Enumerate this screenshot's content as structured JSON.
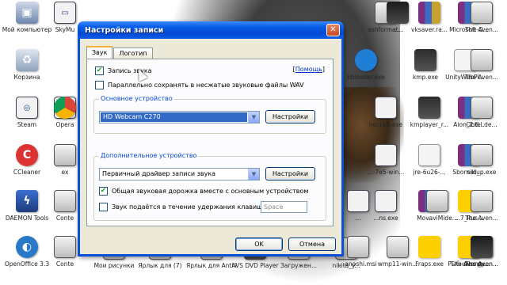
{
  "desktop": {
    "icons": [
      {
        "label": "Мой компьютер",
        "glyph": "▣",
        "style": "g-pc"
      },
      {
        "label": "Корзина",
        "glyph": "♻",
        "style": "g-bin"
      },
      {
        "label": "Steam",
        "glyph": "◎",
        "style": "g-exe"
      },
      {
        "label": "CCleaner",
        "glyph": "C",
        "style": "g-cc"
      },
      {
        "label": "DAEMON Tools",
        "glyph": "ϟ",
        "style": "g-daemon"
      },
      {
        "label": "OpenOffice 3.3",
        "glyph": "◐",
        "style": "g-oo"
      },
      {
        "label": "SkyMu",
        "glyph": "▭",
        "style": "g-exe"
      },
      {
        "label": "Opera",
        "glyph": "O",
        "style": "g-exe"
      },
      {
        "label": "",
        "glyph": "",
        "style": "g-chrome"
      },
      {
        "label": "ex",
        "glyph": "",
        "style": "g-win"
      },
      {
        "label": "Conte",
        "glyph": "",
        "style": "g-win"
      },
      {
        "label": "Conte",
        "glyph": "",
        "style": "g-win"
      },
      {
        "label": "Мои рисунки",
        "glyph": "",
        "style": "g-win"
      },
      {
        "label": "Ярлык для (7)",
        "glyph": "",
        "style": "g-win"
      },
      {
        "label": "Ярлык для AntiVir D...",
        "glyph": "",
        "style": "g-win"
      },
      {
        "label": "AVS DVD Player",
        "glyph": "▶",
        "style": "g-media"
      },
      {
        "label": "Загружен...",
        "glyph": "",
        "style": "g-win"
      },
      {
        "label": "nikita_y...",
        "glyph": "",
        "style": "g-win"
      },
      {
        "label": "ashformat...",
        "glyph": "",
        "style": "g-win"
      },
      {
        "label": "vksaver.ra...",
        "glyph": "",
        "style": "g-rar"
      },
      {
        "label": "Microsoft-O...",
        "glyph": "",
        "style": "g-rar"
      },
      {
        "label": "The Aven...",
        "glyph": "",
        "style": "g-win"
      },
      {
        "label": "kbloader.exe",
        "glyph": "",
        "style": "g-ie"
      },
      {
        "label": "kmp.exe",
        "glyph": "",
        "style": "g-kmp"
      },
      {
        "label": "UnityWebPl...",
        "glyph": "",
        "style": "g-unity"
      },
      {
        "label": "The Aven...",
        "glyph": "",
        "style": "g-win"
      },
      {
        "label": "necraft.exe",
        "glyph": "",
        "style": "g-exe"
      },
      {
        "label": "kmplayer_r...",
        "glyph": "",
        "style": "g-kmp"
      },
      {
        "label": "Aion_2.6...",
        "glyph": "",
        "style": "g-rar"
      },
      {
        "label": "Obtel.de...",
        "glyph": "",
        "style": "g-win"
      },
      {
        "label": "...-7e5-win...",
        "glyph": "",
        "style": "g-exe"
      },
      {
        "label": "jre-6u26-...",
        "glyph": "",
        "style": "g-java"
      },
      {
        "label": "Sborniki_...",
        "glyph": "",
        "style": "g-rar"
      },
      {
        "label": "setup.exe",
        "glyph": "",
        "style": "g-win"
      },
      {
        "label": "...",
        "glyph": "",
        "style": "g-exe"
      },
      {
        "label": "...ns.exe",
        "glyph": "",
        "style": "g-exe"
      },
      {
        "label": "...",
        "glyph": "",
        "style": "g-rar"
      },
      {
        "label": "...7_Rus...",
        "glyph": "",
        "style": "g-yellow"
      },
      {
        "label": "The Aven...",
        "glyph": "",
        "style": "g-win"
      },
      {
        "label": "...anoshi.msi",
        "glyph": "",
        "style": "g-win"
      },
      {
        "label": "wmp11-win...",
        "glyph": "",
        "style": "g-win"
      },
      {
        "label": "Fraps.exe",
        "glyph": "",
        "style": "g-yellow"
      },
      {
        "label": "Рыбные тру...",
        "glyph": "",
        "style": "g-yellow"
      },
      {
        "label": "The Aven...",
        "glyph": "",
        "style": "g-win"
      },
      {
        "label": "...",
        "glyph": "",
        "style": "g-media"
      },
      {
        "label": "MovaviMide...",
        "glyph": "",
        "style": "g-win"
      },
      {
        "label": "The Aveng...",
        "glyph": "",
        "style": "g-yellow"
      },
      {
        "label": "The Aven...",
        "glyph": "",
        "style": "g-media"
      }
    ]
  },
  "dialog": {
    "title": "Настройки записи",
    "close_glyph": "✕",
    "tabs": [
      "Звук",
      "Логотип"
    ],
    "active_tab": 0,
    "record_sound": {
      "label": "Запись звука",
      "checked": true
    },
    "help_link": {
      "before": "[",
      "text": "Помощь",
      "after": "]"
    },
    "save_wav": {
      "label": "Параллельно сохранять в несжатые звуковые файлы WAV",
      "checked": false
    },
    "primary_group": {
      "legend": "Основное устройство",
      "device_value": "HD Webcam C270",
      "settings_label": "Настройки"
    },
    "secondary_group": {
      "legend": "Дополнительное устройство",
      "device_value": "Первичный драйвер записи звука",
      "settings_label": "Настройки",
      "mix_track": {
        "label": "Общая звуковая дорожка вместе с основным устройством",
        "checked": true
      },
      "hold_key": {
        "label": "Звук подаётся в течение удержания клавиши",
        "checked": false
      },
      "hotkey_value": "Space"
    },
    "ok_label": "OK",
    "cancel_label": "Отмена",
    "check_glyph": "✔",
    "dropdown_glyph": "▼"
  },
  "colors": {
    "titlebar": "#0a5ee8",
    "dialog_bg": "#ece9d8",
    "selection": "#316ac5",
    "group_legend": "#0046d5",
    "link": "#0033cc"
  }
}
